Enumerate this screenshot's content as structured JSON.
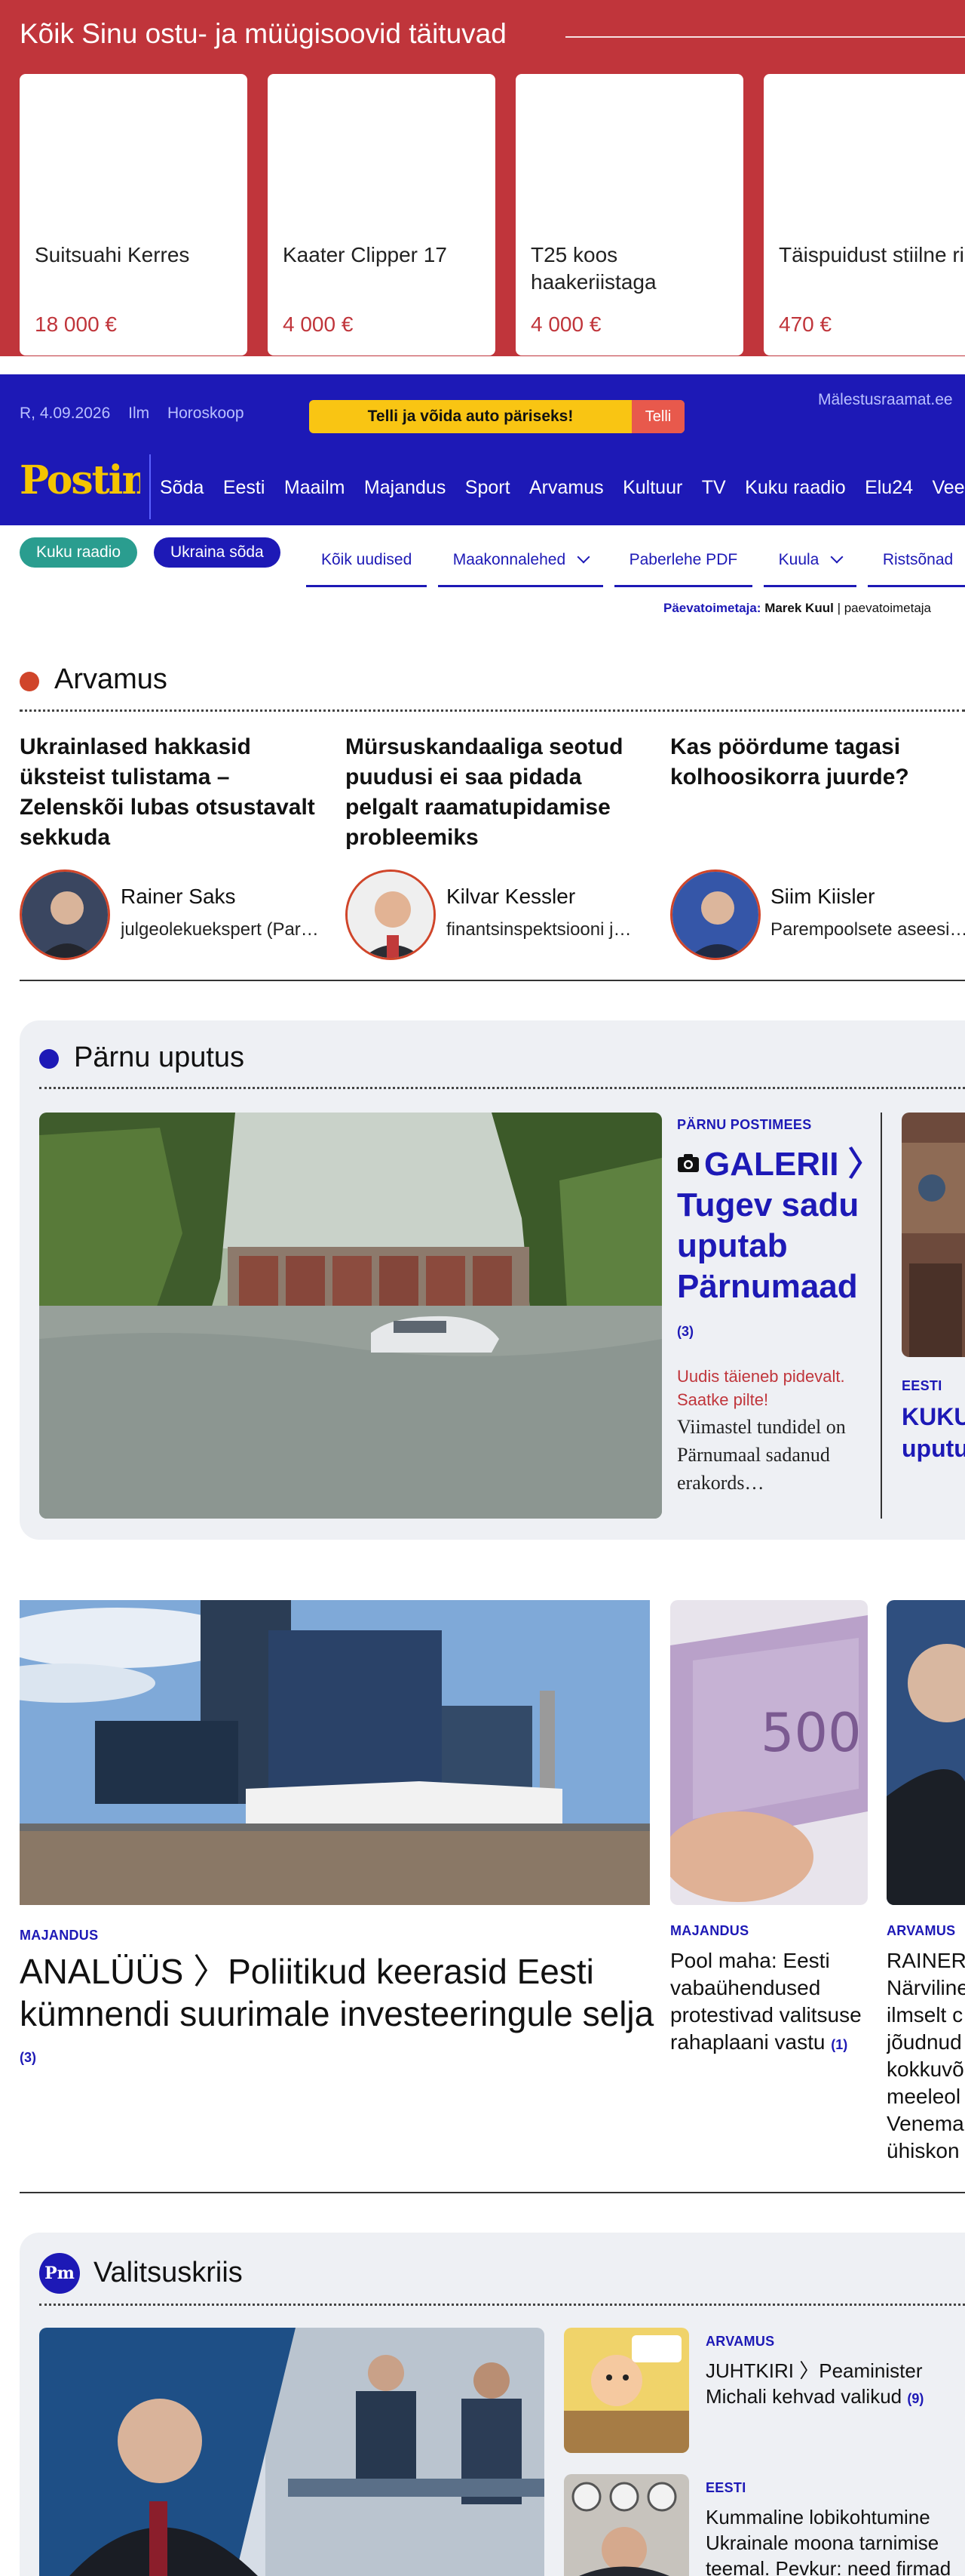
{
  "market": {
    "title": "Kõik Sinu ostu- ja müügisoovid täituvad",
    "items": [
      {
        "title": "Suitsuahi Kerres",
        "price": "18 000 €"
      },
      {
        "title": "Kaater Clipper 17",
        "price": "4 000 €"
      },
      {
        "title": "T25 koos haakeriistaga",
        "price": "4 000 €"
      },
      {
        "title": "Täispuidust stiilne riidekapp ja…",
        "price": "470 €"
      }
    ]
  },
  "header": {
    "date": "R, 4.09.2026",
    "weather": "Ilm",
    "horoscope": "Horoskoop",
    "promo_text": "Telli ja võida auto päriseks!",
    "promo_button": "Telli",
    "memorial_link": "Mälestusraamat.ee",
    "logo": "Postimees",
    "nav": [
      "Sõda",
      "Eesti",
      "Maailm",
      "Majandus",
      "Sport",
      "Arvamus",
      "Kultuur",
      "TV",
      "Kuku raadio",
      "Elu24",
      "Vee"
    ]
  },
  "subnav": {
    "pill_radio": "Kuku raadio",
    "pill_war": "Ukraina sõda",
    "items": [
      "Kõik uudised",
      "Maakonnalehed",
      "Paberlehe PDF",
      "Kuula",
      "Ristsõnad"
    ],
    "editor_label": "Päevatoimetaja:",
    "editor_name": "Marek Kuul",
    "editor_rest": "| paevatoimetaja"
  },
  "opinion": {
    "section": "Arvamus",
    "articles": [
      {
        "title": "Ukrainlased hakkasid üksteist tulistama – Zelenskõi lubas otsustavalt sekkuda",
        "author": "Rainer Saks",
        "role": "julgeolekuekspert (Par…"
      },
      {
        "title": "Mürsuskandaaliga seotud puudusi ei saa pidada pelgalt raamatupidamise probleemiks",
        "author": "Kilvar Kessler",
        "role": "finantsinspektsiooni j…"
      },
      {
        "title": "Kas pöördume tagasi kolhoosikorra juurde?",
        "author": "Siim Kiisler",
        "role": "Parempoolsete aseesi…"
      }
    ]
  },
  "flood": {
    "section": "Pärnu uputus",
    "kicker": "PÄRNU POSTIMEES",
    "title": "GALERII 〉Tugev sadu uputab Pärnumaad",
    "count": "(3)",
    "live": "Uudis täieneb pidevalt. Saatke pilte!",
    "lead": "Viimastel tundidel on Pärnumaal sadanud erakords…",
    "side_kicker": "EESTI",
    "side_title": "KUKU uputu"
  },
  "articles": {
    "main": {
      "kicker": "MAJANDUS",
      "title": "ANALÜÜS 〉Poliitikud keerasid Eesti kümnendi suurimale investeeringule selja",
      "count": "(3)"
    },
    "second": {
      "kicker": "MAJANDUS",
      "title": "Pool maha: Eesti vabaühendused protestivad valitsuse rahaplaani vastu",
      "count": "(1)"
    },
    "third": {
      "kicker": "ARVAMUS",
      "title": "RAINER Närviline ilmselt c jõudnud kokkuvõ meeleol Venema ühiskon"
    }
  },
  "crisis": {
    "badge": "Pm",
    "section": "Valitsuskriis",
    "item1": {
      "kicker": "ARVAMUS",
      "title": "JUHTKIRI 〉Peaminister Michali kehvad valikud",
      "count": "(9)"
    },
    "item2": {
      "kicker": "EESTI",
      "title": "Kummaline lobikohtumine Ukrainale moona tarnimise teemal. Pevkur: need firmad"
    }
  },
  "colors": {
    "brand_blue": "#1d19b6",
    "market_red": "#c0353b",
    "logo_yellow": "#f4c400",
    "opinion_dot": "#d0452a"
  }
}
